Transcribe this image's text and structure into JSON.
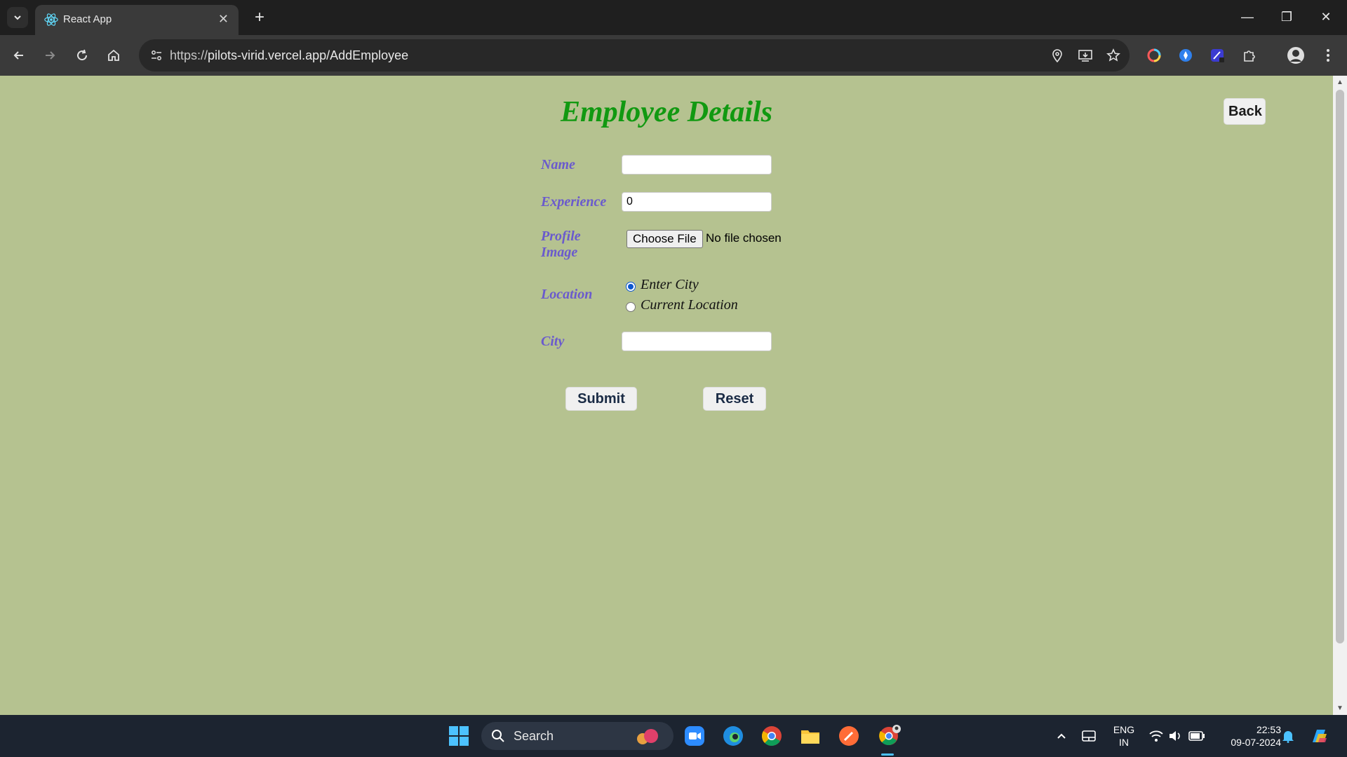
{
  "browser": {
    "tab_title": "React App",
    "url_scheme": "https://",
    "url_rest": "pilots-virid.vercel.app/AddEmployee"
  },
  "page": {
    "title": "Employee Details",
    "back_label": "Back",
    "fields": {
      "name_label": "Name",
      "name_value": "",
      "experience_label": "Experience",
      "experience_value": "0",
      "profile_label_line1": "Profile",
      "profile_label_line2": "Image",
      "file_button": "Choose File",
      "file_status": "No file chosen",
      "location_label": "Location",
      "location_options": [
        "Enter City",
        "Current Location"
      ],
      "location_selected": "Enter City",
      "city_label": "City",
      "city_value": ""
    },
    "submit_label": "Submit",
    "reset_label": "Reset"
  },
  "taskbar": {
    "search_label": "Search",
    "lang_line1": "ENG",
    "lang_line2": "IN",
    "time": "22:53",
    "date": "09-07-2024"
  },
  "colors": {
    "page_bg": "#b5c290",
    "title": "#119911",
    "label": "#6a5acd"
  }
}
